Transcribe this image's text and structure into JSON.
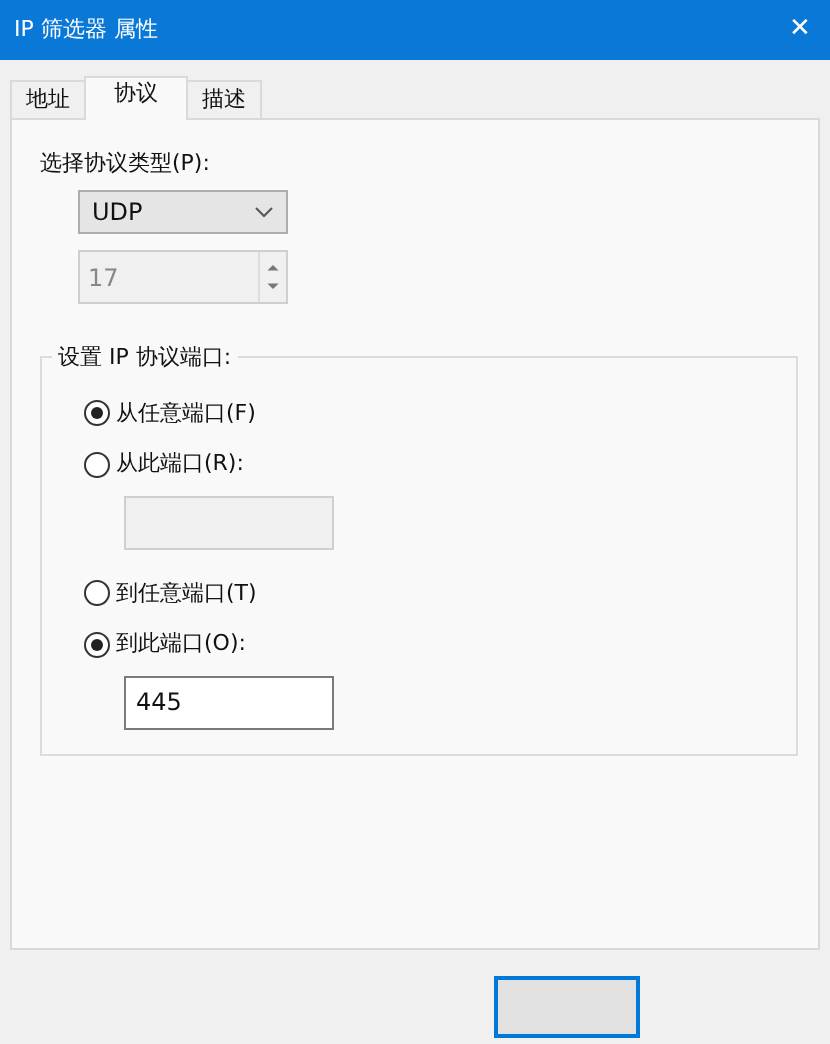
{
  "window": {
    "title": "IP 筛选器 属性",
    "close": "✕"
  },
  "tabs": [
    {
      "label": "地址",
      "selected": false
    },
    {
      "label": "协议",
      "selected": true
    },
    {
      "label": "描述",
      "selected": false
    }
  ],
  "protocol_type": {
    "label": "选择协议类型(P):",
    "value": "UDP",
    "number": "17"
  },
  "port_group": {
    "title": "设置 IP 协议端口:",
    "options": [
      {
        "kind": "radio",
        "label": "从任意端口(F)",
        "selected": true
      },
      {
        "kind": "radio_field",
        "label": "从此端口(R):",
        "selected": false,
        "disabled": true
      },
      {
        "kind": "radio",
        "label": "到任意端口(T)",
        "selected": false
      },
      {
        "kind": "radio_field",
        "label": "到此端口(O):",
        "selected": true,
        "value": "445",
        "disabled": false
      }
    ]
  }
}
